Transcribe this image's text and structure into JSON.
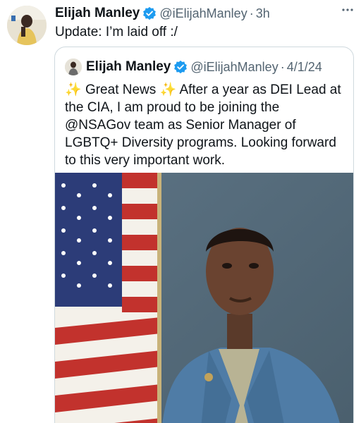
{
  "tweet": {
    "name": "Elijah Manley",
    "handle": "@iElijahManley",
    "separator": "·",
    "time": "3h",
    "text": "Update: I’m laid off :/",
    "more_icon": "more-options-icon"
  },
  "quoted": {
    "name": "Elijah Manley",
    "handle": "@iElijahManley",
    "separator": "·",
    "date": "4/1/24",
    "sparkle": "✨",
    "headline": "Great News",
    "text": "After a year as DEI Lead at the CIA, I am proud to be joining the @NSAGov team as Senior Manager of LGBTQ+ Diversity programs. Looking forward to this very important work."
  },
  "colors": {
    "verified": "#1d9bf0",
    "secondary_text": "#536471",
    "border": "#cfd9de"
  }
}
